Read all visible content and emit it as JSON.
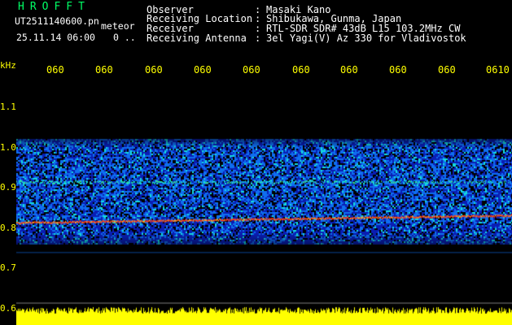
{
  "header": {
    "app_title": "HROFFT",
    "file_name": "UT2511140600.pn",
    "file_suffix": "meteor",
    "date_time": "25.11.14 06:00",
    "count": "0 .."
  },
  "station_info": [
    {
      "label": "Observer",
      "value": "Masaki Kano"
    },
    {
      "label": "Receiving Location",
      "value": "Shibukawa, Gunma, Japan"
    },
    {
      "label": "Receiver",
      "value": "RTL-SDR SDR# 43dB L15 103.2MHz CW"
    },
    {
      "label": "Receiving Antenna",
      "value": "3el Yagi(V) Az 330 for Vladivostok"
    }
  ],
  "spectrogram": {
    "unit_label": "kHz",
    "y_ticks": [
      "1.1",
      "1.0",
      "0.9",
      "0.8",
      "0.7",
      "0.6"
    ],
    "x_ticks": [
      "060",
      "060",
      "060",
      "060",
      "060",
      "060",
      "060",
      "060",
      "060",
      "0610"
    ],
    "frequency_range_khz": [
      0.6,
      1.15
    ],
    "signal_band_khz": [
      0.76,
      1.02
    ],
    "meteor_echo_line_khz": 0.82,
    "secondary_line_khz": 0.915,
    "colors": {
      "background": "#000000",
      "axis_text": "#ffff00",
      "noise_low": "#0a1eb4",
      "noise_mid": "#0f6ef0",
      "noise_high": "#14dcdc",
      "echo_line": "#ff3c14",
      "baseline_trace": "#ffff00"
    }
  }
}
